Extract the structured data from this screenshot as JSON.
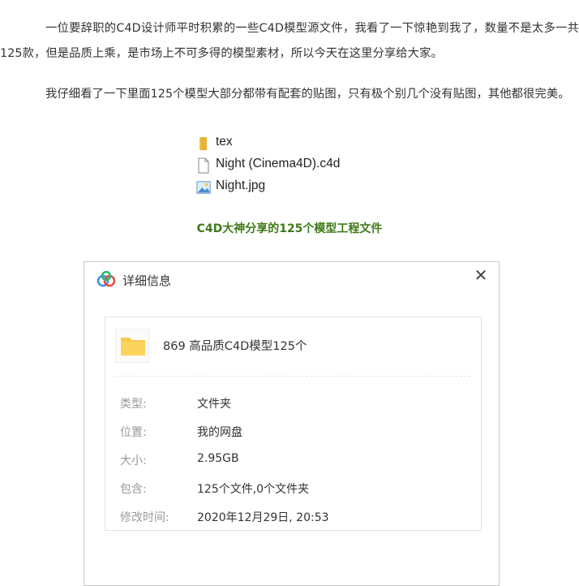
{
  "article": {
    "paragraph1": "一位要辞职的C4D设计师平时积累的一些C4D模型源文件，我看了一下惊艳到我了，数量不是太多一共125款，但是品质上乘，是市场上不可多得的模型素材，所以今天在这里分享给大家。",
    "paragraph2": "我仔细看了一下里面125个模型大部分都带有配套的贴图，只有极个别几个没有贴图，其他都很完美。",
    "caption": "C4D大神分享的125个模型工程文件"
  },
  "file_list": {
    "items": [
      {
        "name": "tex",
        "icon": "folder-icon"
      },
      {
        "name": "Night (Cinema4D).c4d",
        "icon": "document-icon"
      },
      {
        "name": "Night.jpg",
        "icon": "image-file-icon"
      }
    ]
  },
  "dialog": {
    "title": "详细信息",
    "close_glyph": "✕",
    "folder_name": "869 高品质C4D模型125个",
    "type_label": "类型:",
    "type_value": "文件夹",
    "location_label": "位置:",
    "location_value": "我的网盘",
    "size_label": "大小:",
    "size_value": "2.95GB",
    "contains_label": "包含:",
    "contains_value": "125个文件,0个文件夹",
    "modified_label": "修改时间:",
    "modified_value": "2020年12月29日, 20:53"
  },
  "colors": {
    "caption": "#3f7a18",
    "folder_yellow": "#f7c94a",
    "cloud_blue": "#3a8ee6",
    "label_gray": "#999999"
  }
}
